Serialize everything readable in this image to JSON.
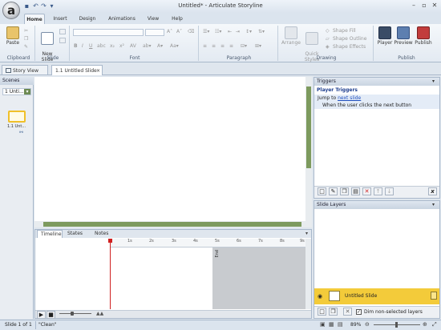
{
  "window": {
    "title": "Untitled* - Articulate Storyline",
    "logo": "a",
    "controls": [
      "–",
      "▫",
      "✕"
    ]
  },
  "ribbon_tabs": [
    {
      "label": "Home",
      "active": true
    },
    {
      "label": "Insert"
    },
    {
      "label": "Design"
    },
    {
      "label": "Animations"
    },
    {
      "label": "View"
    },
    {
      "label": "Help"
    }
  ],
  "ribbon": {
    "clipboard": {
      "label": "Clipboard",
      "paste": "Paste"
    },
    "slide": {
      "label": "Slide",
      "new_slide": "New\nSlide"
    },
    "font": {
      "label": "Font"
    },
    "paragraph": {
      "label": "Paragraph"
    },
    "drawing": {
      "label": "Drawing",
      "arrange": "Arrange",
      "quick_styles": "Quick\nStyles",
      "shape_fill": "Shape Fill",
      "shape_outline": "Shape Outline",
      "shape_effects": "Shape Effects"
    },
    "publish": {
      "label": "Publish",
      "player": "Player",
      "preview": "Preview",
      "publish": "Publish"
    }
  },
  "doc_tabs": [
    {
      "label": "Story View"
    },
    {
      "label": "1.1 Untitled Slide",
      "active": true
    }
  ],
  "scenes": {
    "header": "Scenes",
    "selector": "1 Unti...",
    "slide_label": "1.1 Unt..."
  },
  "timeline": {
    "tabs": [
      "Timeline",
      "States",
      "Notes"
    ],
    "ticks": [
      "1s",
      "2s",
      "3s",
      "4s",
      "5s",
      "6s",
      "7s",
      "8s",
      "9s"
    ],
    "end_label": "End"
  },
  "triggers": {
    "header": "Triggers",
    "section": "Player Triggers",
    "jump_text": "Jump to ",
    "jump_link": "next slide",
    "when_text": "When the user clicks the next button",
    "menu_icon": "▾"
  },
  "layers": {
    "header": "Slide Layers",
    "base_layer": "Untitled Slide",
    "dim_label": "Dim non-selected layers"
  },
  "status": {
    "slide": "Slide 1 of 1",
    "theme": "\"Clean\"",
    "zoom": "89%"
  },
  "colors": {
    "accent": "#6d8a52",
    "layer_highlight": "#f3cb3a",
    "link": "#1f4fbf",
    "playhead": "#d02020"
  }
}
